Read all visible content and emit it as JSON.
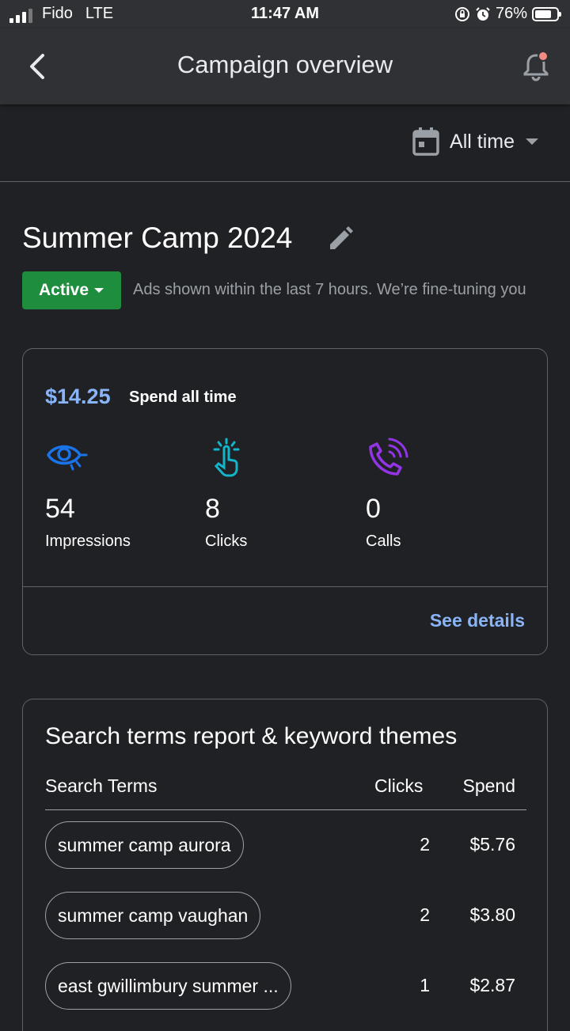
{
  "status_bar": {
    "carrier": "Fido",
    "network": "LTE",
    "time": "11:47 AM",
    "battery": "76%",
    "battery_level": 0.76
  },
  "app_bar": {
    "title": "Campaign overview",
    "notification_dot_color": "#f28b82"
  },
  "filter": {
    "date_range": "All time"
  },
  "campaign": {
    "name": "Summer Camp 2024",
    "status": "Active",
    "status_color": "#1e8e3e",
    "status_message": "Ads shown within the last 7 hours. We’re fine-tuning you"
  },
  "performance": {
    "spend_value": "$14.25",
    "spend_label": "Spend all time",
    "metrics": [
      {
        "icon": "eye-icon",
        "value": "54",
        "label": "Impressions",
        "color": "#1a73e8"
      },
      {
        "icon": "tap-icon",
        "value": "8",
        "label": "Clicks",
        "color": "#12b5cb"
      },
      {
        "icon": "phone-icon",
        "value": "0",
        "label": "Calls",
        "color": "#9334e6"
      }
    ],
    "see_details": "See details"
  },
  "search_terms": {
    "title": "Search terms report & keyword themes",
    "columns": {
      "term": "Search Terms",
      "clicks": "Clicks",
      "spend": "Spend"
    },
    "rows": [
      {
        "term": "summer camp aurora",
        "clicks": "2",
        "spend": "$5.76"
      },
      {
        "term": "summer camp vaughan",
        "clicks": "2",
        "spend": "$3.80"
      },
      {
        "term": "east gwillimbury summer ...",
        "clicks": "1",
        "spend": "$2.87"
      }
    ]
  }
}
